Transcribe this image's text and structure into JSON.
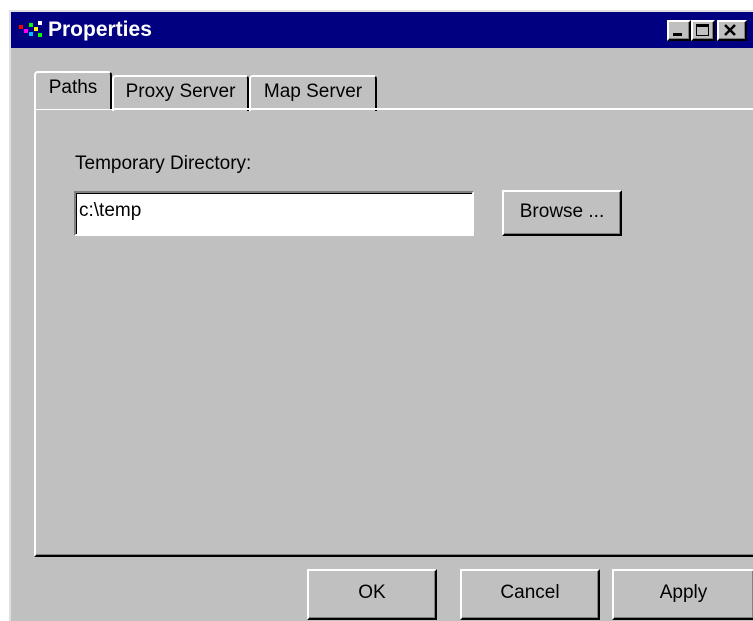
{
  "window": {
    "title": "Properties",
    "title_bar_color": "#000080",
    "face_color": "#c0c0c0",
    "controls": [
      "minimize-icon",
      "maximize-icon",
      "close-icon"
    ]
  },
  "tabs": [
    {
      "label": "Paths",
      "active": true
    },
    {
      "label": "Proxy Server",
      "active": false
    },
    {
      "label": "Map Server",
      "active": false
    }
  ],
  "paths": {
    "temp_dir_label": "Temporary Directory:",
    "temp_dir_value": "c:\\temp",
    "browse_label": "Browse ..."
  },
  "footer": {
    "ok_label": "OK",
    "cancel_label": "Cancel",
    "apply_label": "Apply"
  }
}
